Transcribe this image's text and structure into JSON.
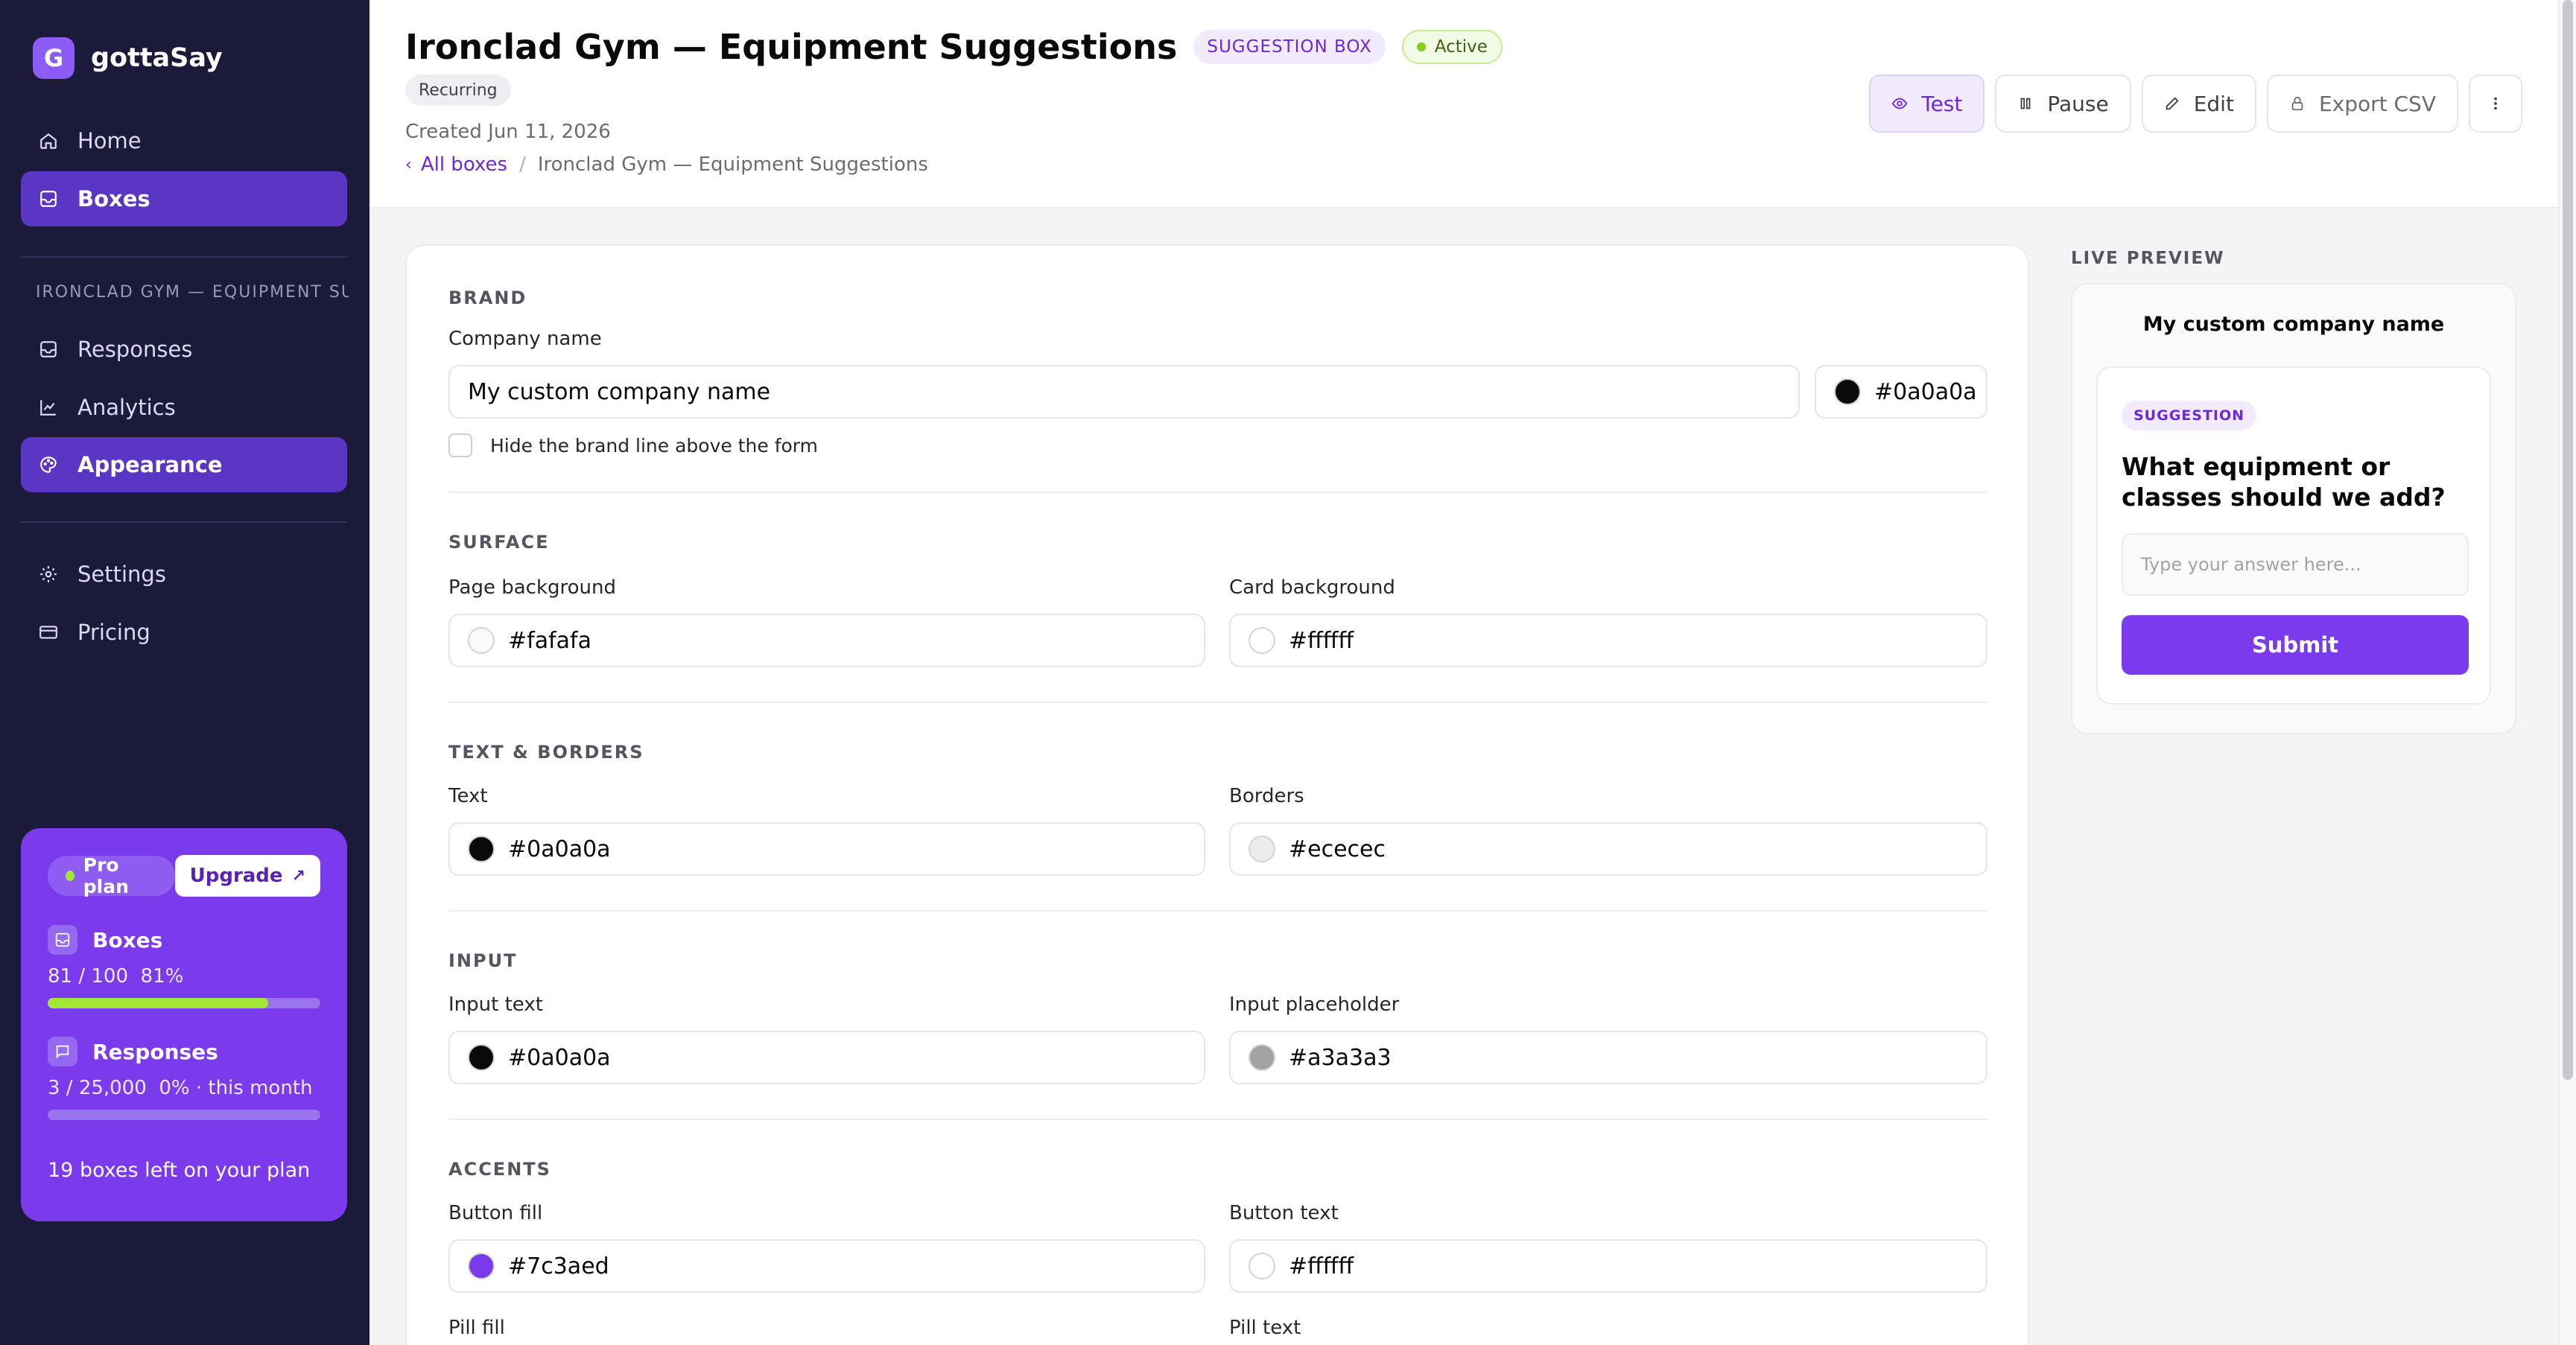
{
  "app": {
    "name": "gottaSay",
    "logo_letter": "G"
  },
  "sidebar": {
    "nav": [
      {
        "label": "Home",
        "icon": "home-icon"
      },
      {
        "label": "Boxes",
        "icon": "inbox-icon"
      }
    ],
    "section_title": "IRONCLAD GYM — EQUIPMENT SUGGESTIONS",
    "box_nav": [
      {
        "label": "Responses",
        "icon": "inbox-icon"
      },
      {
        "label": "Analytics",
        "icon": "chart-icon"
      },
      {
        "label": "Appearance",
        "icon": "palette-icon"
      }
    ],
    "bottom_nav": [
      {
        "label": "Settings",
        "icon": "gear-icon"
      },
      {
        "label": "Pricing",
        "icon": "card-icon"
      }
    ],
    "plan": {
      "name": "Pro plan",
      "upgrade_label": "Upgrade",
      "boxes": {
        "title": "Boxes",
        "usage": "81 / 100  81%",
        "fraction": 0.81
      },
      "responses": {
        "title": "Responses",
        "usage": "3 / 25,000  0% · this month",
        "fraction": 0.0
      },
      "footer": "19 boxes left on your plan"
    }
  },
  "header": {
    "title": "Ironclad Gym — Equipment Suggestions",
    "type_badge": "SUGGESTION BOX",
    "status_badge": "Active",
    "recurring_badge": "Recurring",
    "created": "Created Jun 11, 2026",
    "breadcrumb": {
      "link": "All boxes",
      "separator": "/",
      "current": "Ironclad Gym — Equipment Suggestions"
    },
    "actions": {
      "test": "Test",
      "pause": "Pause",
      "edit": "Edit",
      "export": "Export CSV"
    }
  },
  "form": {
    "brand": {
      "section": "BRAND",
      "company_label": "Company name",
      "company_value": "My custom company name",
      "brand_color": "#0a0a0a",
      "hide_label": "Hide the brand line above the form"
    },
    "surface": {
      "section": "SURFACE",
      "page_bg_label": "Page background",
      "page_bg": "#fafafa",
      "card_bg_label": "Card background",
      "card_bg": "#ffffff"
    },
    "text_borders": {
      "section": "TEXT & BORDERS",
      "text_label": "Text",
      "text": "#0a0a0a",
      "borders_label": "Borders",
      "borders": "#ececec"
    },
    "input": {
      "section": "INPUT",
      "text_label": "Input text",
      "text": "#0a0a0a",
      "placeholder_label": "Input placeholder",
      "placeholder": "#a3a3a3"
    },
    "accents": {
      "section": "ACCENTS",
      "button_fill_label": "Button fill",
      "button_fill": "#7c3aed",
      "button_text_label": "Button text",
      "button_text": "#ffffff",
      "pill_fill_label": "Pill fill",
      "pill_text_label": "Pill text"
    }
  },
  "preview": {
    "label": "LIVE PREVIEW",
    "brand": "My custom company name",
    "pill": "SUGGESTION",
    "question": "What equipment or classes should we add?",
    "placeholder": "Type your answer here...",
    "submit": "Submit"
  },
  "colors": {
    "sidebar_bg": "#1c1a3a",
    "accent": "#7c3aed",
    "active_nav": "#5b35c4",
    "lime": "#a3e635"
  }
}
